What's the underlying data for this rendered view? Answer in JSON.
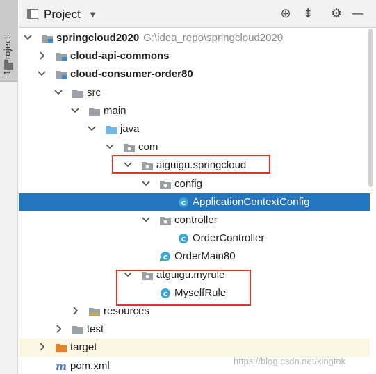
{
  "tool_window": {
    "stripe_label": "1: Project",
    "title": "Project",
    "dropdown_caret": "▼",
    "actions": [
      {
        "name": "locate-icon",
        "glyph": "⊕"
      },
      {
        "name": "collapse-all-icon",
        "glyph": "⇟"
      },
      {
        "name": "settings-gear-icon",
        "glyph": "⚙"
      },
      {
        "name": "hide-icon",
        "glyph": "—"
      }
    ]
  },
  "tree": [
    {
      "label": "springcloud2020",
      "path": "G:\\idea_repo\\springcloud2020",
      "icon": "module-folder-icon",
      "arrow": "down",
      "bold": true
    },
    {
      "label": "cloud-api-commons",
      "icon": "module-folder-icon",
      "arrow": "right",
      "bold": true
    },
    {
      "label": "cloud-consumer-order80",
      "icon": "module-folder-icon",
      "arrow": "down",
      "bold": true
    },
    {
      "label": "src",
      "icon": "folder-icon",
      "arrow": "down"
    },
    {
      "label": "main",
      "icon": "folder-icon",
      "arrow": "down"
    },
    {
      "label": "java",
      "icon": "source-root-icon",
      "arrow": "down"
    },
    {
      "label": "com",
      "icon": "package-icon",
      "arrow": "down"
    },
    {
      "label": "aiguigu.springcloud",
      "icon": "package-icon",
      "arrow": "down"
    },
    {
      "label": "config",
      "icon": "package-icon",
      "arrow": "down"
    },
    {
      "label": "ApplicationContextConfig",
      "icon": "class-icon",
      "arrow": "none",
      "selected": true
    },
    {
      "label": "controller",
      "icon": "package-icon",
      "arrow": "down"
    },
    {
      "label": "OrderController",
      "icon": "class-icon",
      "arrow": "none"
    },
    {
      "label": "OrderMain80",
      "icon": "main-class-icon",
      "arrow": "none"
    },
    {
      "label": "atguigu.myrule",
      "icon": "package-icon",
      "arrow": "down"
    },
    {
      "label": "MyselfRule",
      "icon": "class-icon",
      "arrow": "none"
    },
    {
      "label": "resources",
      "icon": "resources-folder-icon",
      "arrow": "right"
    },
    {
      "label": "test",
      "icon": "folder-icon",
      "arrow": "right"
    },
    {
      "label": "target",
      "icon": "excluded-folder-icon",
      "arrow": "right"
    },
    {
      "label": "pom.xml",
      "icon": "maven-file-icon",
      "arrow": "none"
    }
  ],
  "watermark": "https://blog.csdn.net/kingtok",
  "colors": {
    "selection": "#2675bf",
    "highlight_box": "#e0332b",
    "class_icon": "#3fa4d8",
    "target_folder": "#e5822a"
  }
}
